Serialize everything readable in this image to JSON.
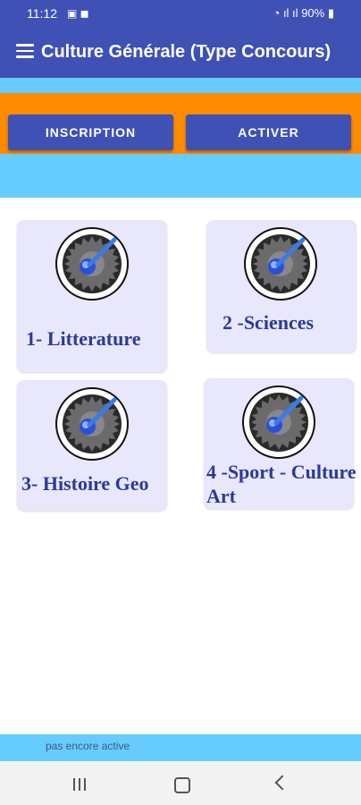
{
  "status_bar": {
    "time": "11:12",
    "battery": "90%"
  },
  "app_bar": {
    "title": "Culture Générale (Type Concours)"
  },
  "buttons": {
    "inscription": "INSCRIPTION",
    "activer": "ACTIVER"
  },
  "categories": [
    {
      "label": "1- Litterature"
    },
    {
      "label": "2 -Sciences"
    },
    {
      "label": "3- Histoire Geo"
    },
    {
      "label_line1": "4 -Sport - Culture",
      "label_line2": "Art"
    }
  ],
  "footer": {
    "status_text": "pas encore active"
  },
  "colors": {
    "primary": "#3f51b5",
    "accent_orange": "#ff8c00",
    "background_blue": "#66ccff",
    "card_bg": "#e9e7fb",
    "card_text": "#2b3a9a"
  },
  "icons": {
    "card_icon": "gear-wrench-icon",
    "menu": "hamburger-menu-icon"
  }
}
